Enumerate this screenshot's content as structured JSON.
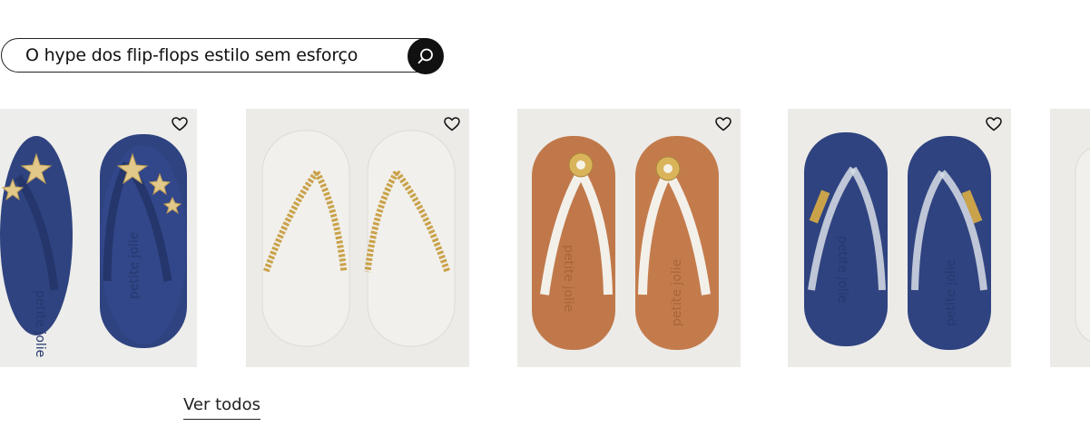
{
  "collection": {
    "title": "O hype dos flip-flops estilo sem esforço",
    "see_all_label": "Ver todos"
  },
  "products": [
    {
      "sole_color": "#2f4380",
      "strap_color": "#2f4380",
      "accent": "starfish",
      "accent_color": "#e2c98a",
      "brand_mark": "petite jolie"
    },
    {
      "sole_color": "#f1efeb",
      "strap_color": "#efece7",
      "accent": "gold-chain",
      "accent_color": "#c9a24a"
    },
    {
      "sole_color": "#c0784a",
      "strap_color": "#f3f0ea",
      "accent": "flower-charm",
      "accent_color": "#d9b45a",
      "brand_mark": "petite jolie"
    },
    {
      "sole_color": "#2f4380",
      "strap_color": "#d7dde6",
      "accent": "gold-stones",
      "accent_color": "#c9a24a",
      "brand_mark": "petite jolie"
    },
    {
      "sole_color": "#f1efeb",
      "strap_color": "#efece7",
      "accent": "none"
    }
  ],
  "icons": {
    "search": "search-icon",
    "favorite": "heart-icon"
  }
}
